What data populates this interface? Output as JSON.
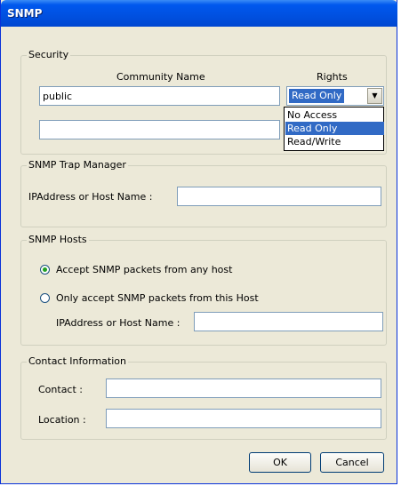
{
  "window": {
    "title": "SNMP"
  },
  "security": {
    "legend": "Security",
    "community_name_header": "Community Name",
    "rights_header": "Rights",
    "community_1_value": "public",
    "community_2_value": "",
    "rights_selected": "Read Only",
    "rights_options": [
      "No Access",
      "Read Only",
      "Read/Write"
    ]
  },
  "trap_manager": {
    "legend": "SNMP Trap Manager",
    "ip_label": "IPAddress or Host Name :",
    "ip_value": ""
  },
  "hosts": {
    "legend": "SNMP Hosts",
    "option_any": "Accept SNMP packets from any host",
    "option_this": "Only accept SNMP packets from this Host",
    "selected": "any",
    "ip_label": "IPAddress or Host Name :",
    "ip_value": ""
  },
  "contact": {
    "legend": "Contact Information",
    "contact_label": "Contact :",
    "contact_value": "",
    "location_label": "Location :",
    "location_value": ""
  },
  "buttons": {
    "ok": "OK",
    "cancel": "Cancel"
  },
  "icons": {
    "dropdown_arrow": "chevron-down-icon",
    "selected_radio": "radio-selected-dot"
  },
  "colors": {
    "title_bar": "#0054e3",
    "window_bg": "#ece9d8",
    "selection": "#316ac5"
  }
}
